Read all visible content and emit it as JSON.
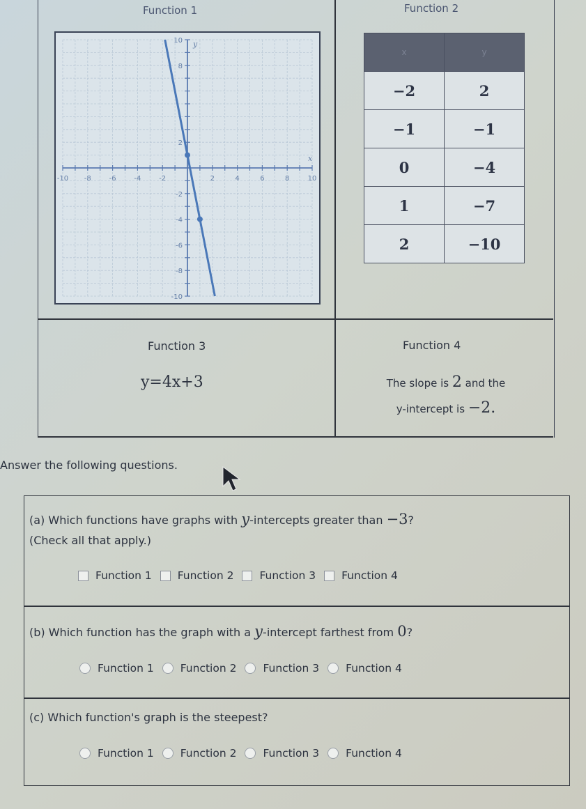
{
  "functions": {
    "f1": {
      "title": "Function 1",
      "graph": {
        "x_axis_label": "x",
        "y_axis_label": "y",
        "x_ticks": [
          "-10",
          "-8",
          "-6",
          "-4",
          "-2",
          "2",
          "4",
          "6",
          "8",
          "10"
        ],
        "y_ticks": [
          "10",
          "8",
          "2",
          "-2",
          "-4",
          "-6",
          "-8",
          "-10"
        ],
        "xlim": [
          -10,
          10
        ],
        "ylim": [
          -10,
          10
        ],
        "line": {
          "slope": -5,
          "intercept": 1
        },
        "points": [
          [
            0,
            1
          ],
          [
            1,
            -4
          ]
        ],
        "line_color": "#4a78b8"
      }
    },
    "f2": {
      "title": "Function 2",
      "table": {
        "headers": [
          "x",
          "y"
        ],
        "rows": [
          [
            "−2",
            "2"
          ],
          [
            "−1",
            "−1"
          ],
          [
            "0",
            "−4"
          ],
          [
            "1",
            "−7"
          ],
          [
            "2",
            "−10"
          ]
        ]
      }
    },
    "f3": {
      "title": "Function 3",
      "equation": "y=4x+3"
    },
    "f4": {
      "title": "Function 4",
      "text_part1": "The slope is",
      "slope": "2",
      "text_part2": "and the",
      "text_part3": "y-intercept is",
      "intercept": "−2."
    }
  },
  "instructions": "Answer the following questions.",
  "questions": {
    "a": {
      "prefix": "(a) Which functions have graphs with",
      "italic": "y",
      "suffix": "-intercepts greater than",
      "value": "−3",
      "end": "?",
      "line2": "(Check all that apply.)",
      "options": [
        "Function 1",
        "Function 2",
        "Function 3",
        "Function 4"
      ]
    },
    "b": {
      "prefix": "(b) Which function has the graph with a",
      "italic": "y",
      "suffix": "-intercept farthest from",
      "value": "0",
      "end": "?",
      "options": [
        "Function 1",
        "Function 2",
        "Function 3",
        "Function 4"
      ]
    },
    "c": {
      "text": "(c) Which function's graph is the steepest?",
      "options": [
        "Function 1",
        "Function 2",
        "Function 3",
        "Function 4"
      ]
    }
  }
}
